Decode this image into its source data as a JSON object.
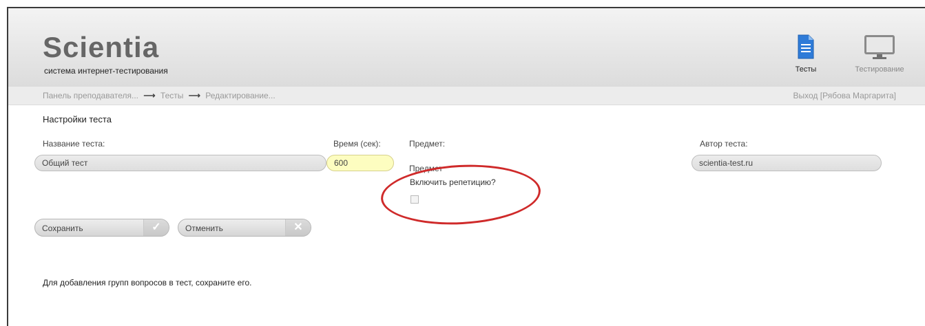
{
  "header": {
    "logo": "Scientia",
    "subtitle": "система интернет-тестирования",
    "nav": [
      {
        "label": "Тесты",
        "icon": "document-icon",
        "active": true
      },
      {
        "label": "Тестирование",
        "icon": "monitor-icon",
        "active": false
      }
    ]
  },
  "breadcrumb": {
    "items": [
      "Панель преподавателя...",
      "Тесты",
      "Редактирование..."
    ],
    "separator": "⟶",
    "logout": "Выход [Рябова Маргарита]"
  },
  "form": {
    "section_title": "Настройки теста",
    "name_label": "Название теста:",
    "name_value": "Общий тест",
    "time_label": "Время (сек):",
    "time_value": "600",
    "subject_label": "Предмет:",
    "subject_value": "Предмет",
    "author_label": "Автор теста:",
    "author_value": "scientia-test.ru",
    "repetition_label": "Включить репетицию?",
    "repetition_checked": false
  },
  "buttons": {
    "save": "Сохранить",
    "cancel": "Отменить"
  },
  "note": "Для добавления групп вопросов в тест, сохраните его.",
  "colors": {
    "accent_icon": "#2e7bd8",
    "annotation": "#cf2a2a",
    "time_field": "#fdfdc0"
  }
}
